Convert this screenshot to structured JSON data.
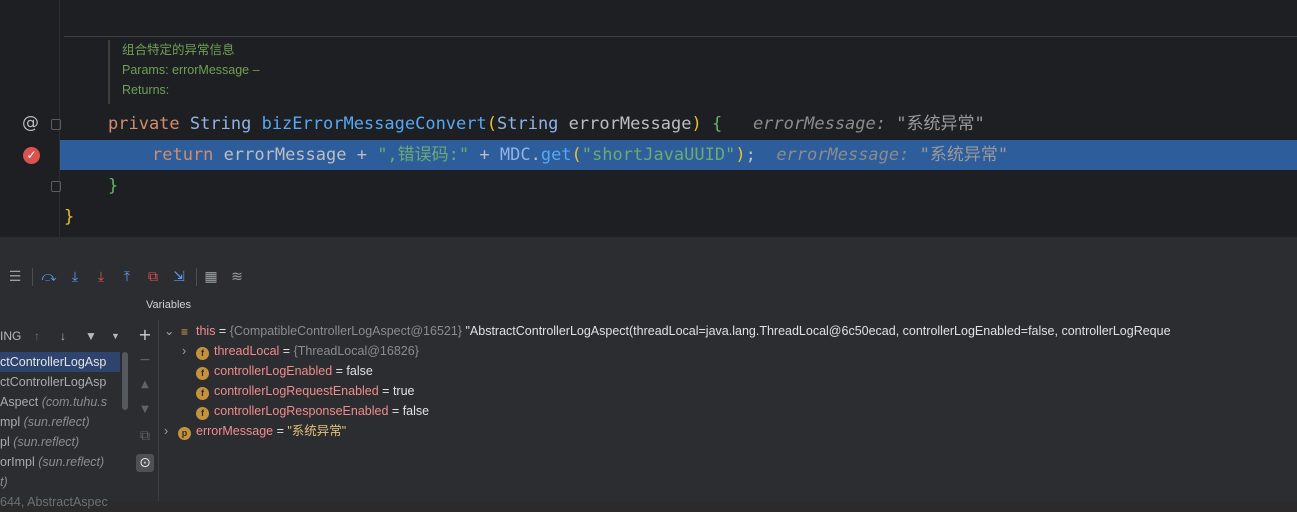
{
  "editor": {
    "doc_comment": [
      "组合特定的异常信息",
      "Params: errorMessage –",
      "Returns:"
    ],
    "line1": {
      "kw_private": "private",
      "type_string": "String",
      "method": "bizErrorMessageConvert",
      "paren_open": "(",
      "param_type": "String",
      "param_name": " errorMessage",
      "paren_close": ")",
      "brace": " {",
      "hint_name": "errorMessage:",
      "hint_value": "\"系统异常\""
    },
    "line2": {
      "kw_return": "return",
      "expr_a": " errorMessage + ",
      "str_a": "\",错误码:\"",
      "plus": " + ",
      "mdc": "MDC",
      "dot": ".",
      "get": "get",
      "paren_open": "(",
      "str_b": "\"shortJavaUUID\"",
      "paren_close": ")",
      "semi": ";",
      "hint_name": "errorMessage:",
      "hint_value": "\"系统异常\""
    },
    "line3": {
      "brace": "}"
    },
    "line4": {
      "brace": "}"
    },
    "gutter": {
      "at_marker": "@",
      "breakpoint": "✓"
    }
  },
  "debugger": {
    "toolbar_icons": [
      "layout-icon",
      "step-over-icon",
      "step-into-icon",
      "force-step-into-icon",
      "step-out-icon",
      "drop-frame-icon",
      "run-to-cursor-icon",
      "evaluate-icon",
      "trace-icon"
    ],
    "variables_label": "Variables",
    "frames_header": "ING",
    "frames": [
      {
        "text": "ctControllerLogAsp",
        "pkg": "",
        "selected": true
      },
      {
        "text": "ctControllerLogAsp",
        "pkg": "",
        "selected": false
      },
      {
        "text": "Aspect ",
        "pkg": "(com.tuhu.s",
        "selected": false
      },
      {
        "text": "mpl ",
        "pkg": "(sun.reflect)",
        "selected": false
      },
      {
        "text": "pl ",
        "pkg": "(sun.reflect)",
        "selected": false
      },
      {
        "text": "orImpl ",
        "pkg": "(sun.reflect)",
        "selected": false
      },
      {
        "text": "t)",
        "pkg": "",
        "selected": false
      },
      {
        "text": "644, AbstractAspec",
        "pkg": "",
        "selected": false
      }
    ],
    "variables": {
      "this": {
        "name": "this",
        "eq": " = ",
        "obj": "{CompatibleControllerLogAspect@16521}",
        "value": " \"AbstractControllerLogAspect(threadLocal=java.lang.ThreadLocal@6c50ecad, controllerLogEnabled=false, controllerLogReque"
      },
      "threadLocal": {
        "name": "threadLocal",
        "eq": " = ",
        "obj": "{ThreadLocal@16826}"
      },
      "controllerLogEnabled": {
        "name": "controllerLogEnabled",
        "eq": " = ",
        "value": "false"
      },
      "controllerLogRequestEnabled": {
        "name": "controllerLogRequestEnabled",
        "eq": " = ",
        "value": "true"
      },
      "controllerLogResponseEnabled": {
        "name": "controllerLogResponseEnabled",
        "eq": " = ",
        "value": "false"
      },
      "errorMessage": {
        "name": "errorMessage",
        "eq": " = ",
        "value": "\"系统异常\""
      }
    },
    "badges": {
      "field": "f",
      "param": "p"
    }
  }
}
